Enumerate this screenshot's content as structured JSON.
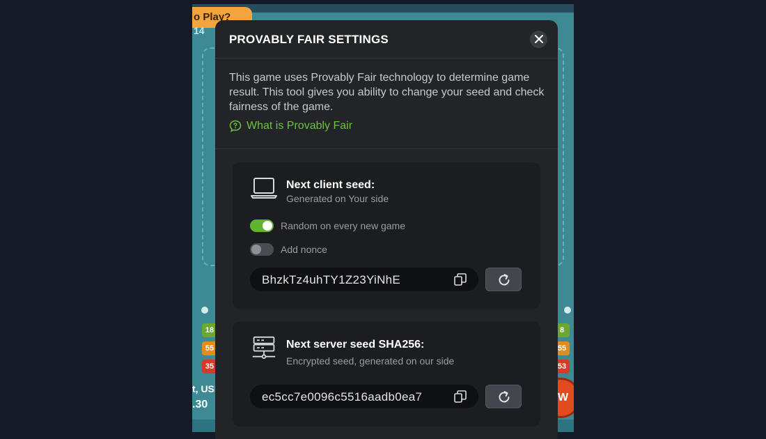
{
  "background_game": {
    "howto_label": "o Play?",
    "round_number": "14",
    "left_badges": [
      "18",
      "55",
      "35"
    ],
    "right_badges": [
      "8",
      "55",
      "53"
    ],
    "currency_label": "t, USI",
    "balance_value": ".30",
    "go_button_label": "W"
  },
  "modal": {
    "title": "PROVABLY FAIR SETTINGS",
    "close_icon": "close-icon",
    "intro_text": "This game uses Provably Fair technology to determine game result. This tool gives you ability to change your seed and check fairness of the game.",
    "info_link": "What is Provably Fair",
    "client_seed": {
      "title": "Next client seed:",
      "subtitle": "Generated on Your side",
      "icon": "laptop-icon",
      "toggle_random_label": "Random on every new game",
      "toggle_random_on": true,
      "toggle_nonce_label": "Add nonce",
      "toggle_nonce_on": false,
      "seed_value": "BhzkTz4uhTY1Z23YiNhE"
    },
    "server_seed": {
      "title": "Next server seed SHA256:",
      "subtitle": "Encrypted seed, generated on our side",
      "icon": "server-icon",
      "seed_value": "ec5cc7e0096c5516aadb0ea7"
    }
  },
  "colors": {
    "accent_green": "#6bc43d",
    "modal_bg": "#232427",
    "card_bg": "#1c1d20",
    "page_bg": "#151a27",
    "game_bg": "#3d8a94"
  }
}
